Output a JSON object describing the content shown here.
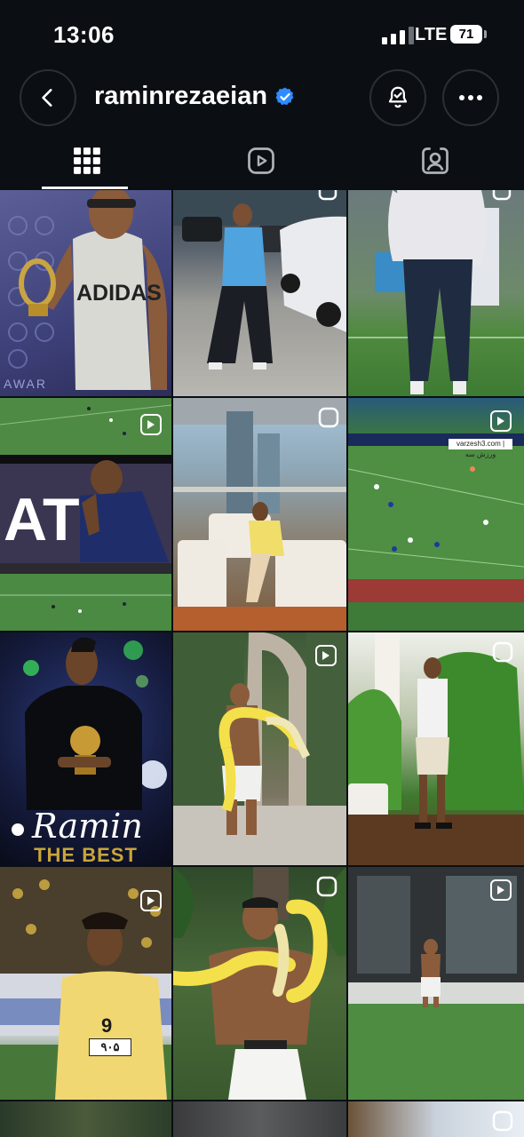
{
  "status": {
    "time": "13:06",
    "network": "LTE",
    "battery": "71"
  },
  "profile": {
    "username": "raminrezaeian",
    "verified": true
  },
  "tabs": [
    "posts-grid",
    "reels",
    "tagged"
  ],
  "posts": [
    {
      "text": "ADIDAS"
    },
    {
      "text": "AWAR"
    },
    {
      "text": "AT"
    },
    {
      "text": "varzesh3.com | ورزش سه"
    },
    {
      "text": "Ramin"
    },
    {
      "text": "THE BEST"
    },
    {
      "text": "9"
    },
    {
      "text": "۹۰۵"
    }
  ],
  "colors": {
    "background": "#0b0f14",
    "verified": "#2f8cff",
    "grass": "#3f7a3c"
  }
}
